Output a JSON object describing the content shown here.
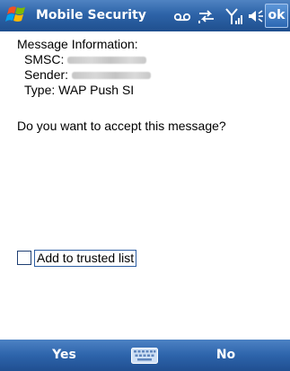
{
  "titlebar": {
    "app_title": "Mobile Security",
    "ok_label": "ok",
    "icons": [
      "windows-start-icon",
      "voicemail-icon",
      "sync-icon",
      "signal-icon",
      "speaker-icon"
    ]
  },
  "message": {
    "heading": "Message Information:",
    "smsc_label": "SMSC:",
    "sender_label": "Sender:",
    "type_label": "Type:",
    "type_value": "WAP Push SI",
    "question": "Do you want to accept this message?"
  },
  "options": {
    "trusted_label": "Add to trusted list",
    "trusted_checked": false
  },
  "softkeys": {
    "left": "Yes",
    "right": "No",
    "center_icon": "keyboard-icon"
  },
  "colors": {
    "bar_top": "#4f83c2",
    "bar_bottom": "#1f4f8e",
    "text": "#000000",
    "focus_border": "#2d5ea3"
  }
}
